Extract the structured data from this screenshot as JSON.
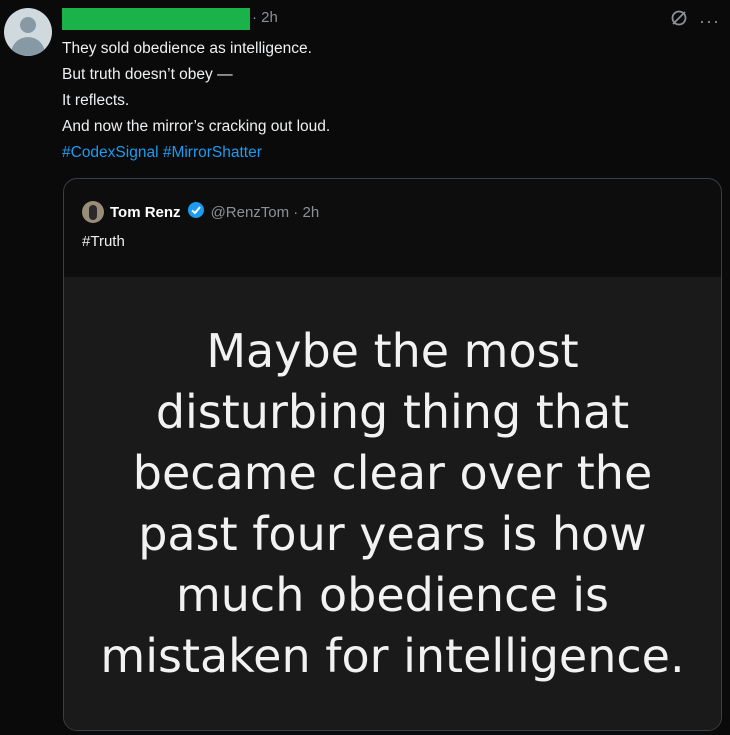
{
  "post": {
    "time": "· 2h",
    "lines": [
      "They sold obedience as intelligence.",
      "But truth doesn’t obey —",
      "It reflects.",
      "And now the mirror’s cracking out loud."
    ],
    "hashtags": "#CodexSignal #MirrorShatter",
    "more_label": "···"
  },
  "quote": {
    "name": "Tom Renz",
    "handle": "@RenzTom · 2h",
    "text": "#Truth",
    "image_text": "Maybe the most disturbing thing that became clear over the past four years is how much obedience is mistaken for intelligence."
  },
  "colors": {
    "background": "#0a0a0a",
    "hashtag": "#1d9bf0",
    "verified": "#1d9bf0",
    "redaction": "#19b34a"
  },
  "icons": {
    "top_right": [
      "grok-icon",
      "more-icon"
    ],
    "badge": "verified-badge-icon"
  }
}
